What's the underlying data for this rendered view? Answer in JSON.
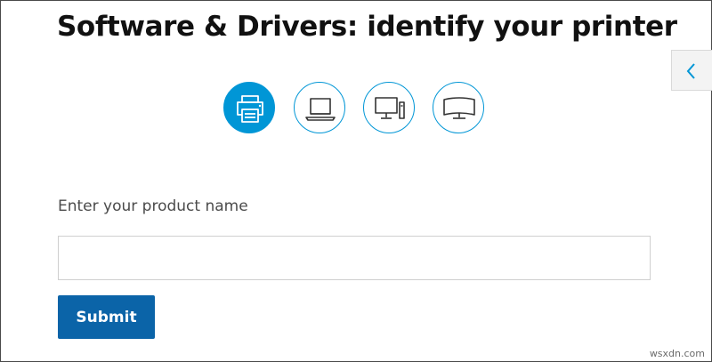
{
  "header": {
    "title": "Software & Drivers: identify your printer"
  },
  "side_panel": {
    "toggle_icon": "chevron-left-icon"
  },
  "device_types": [
    {
      "icon": "printer-icon",
      "selected": true
    },
    {
      "icon": "laptop-icon",
      "selected": false
    },
    {
      "icon": "desktop-icon",
      "selected": false
    },
    {
      "icon": "monitor-icon",
      "selected": false
    }
  ],
  "form": {
    "label": "Enter your product name",
    "input_value": "",
    "input_placeholder": "",
    "submit_label": "Submit"
  },
  "watermark": "wsxdn.com",
  "colors": {
    "accent": "#0096d6",
    "submit": "#0b64a8",
    "title": "#111111"
  }
}
